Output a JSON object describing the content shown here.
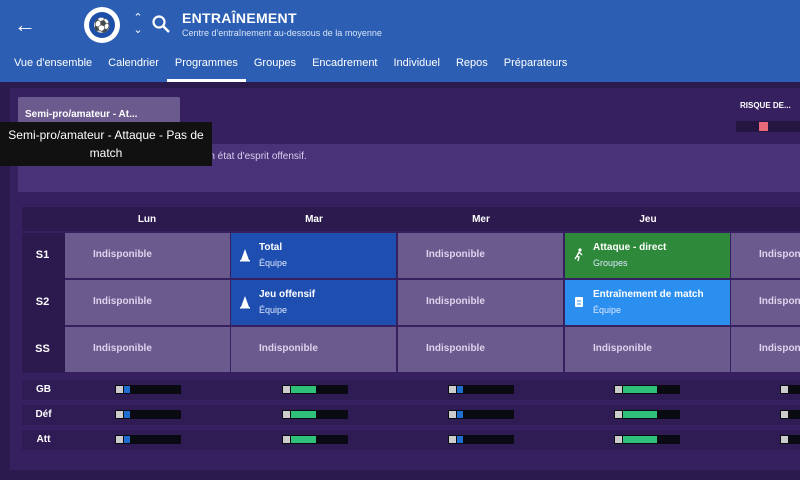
{
  "header": {
    "title": "ENTRAÎNEMENT",
    "subtitle": "Centre d'entraînement au-dessous de la moyenne"
  },
  "tabs": [
    {
      "label": "Vue d'ensemble"
    },
    {
      "label": "Calendrier"
    },
    {
      "label": "Programmes",
      "active": true
    },
    {
      "label": "Groupes"
    },
    {
      "label": "Encadrement"
    },
    {
      "label": "Individuel"
    },
    {
      "label": "Repos"
    },
    {
      "label": "Préparateurs"
    }
  ],
  "program": {
    "selected": "Semi-pro/amateur - At...",
    "tooltip": "Semi-pro/amateur - Attaque - Pas de match",
    "description": "Un programme d'entraînement basé sur un état d'esprit offensif.",
    "risk_label": "RISQUE DE..."
  },
  "days": [
    "Lun",
    "Mar",
    "Mer",
    "Jeu"
  ],
  "sessions": [
    "S1",
    "S2",
    "SS"
  ],
  "unavailable_label": "Indisponible",
  "cells": {
    "mar_s1": {
      "title": "Total",
      "sub": "Équipe"
    },
    "mar_s2": {
      "title": "Jeu offensif",
      "sub": "Équipe"
    },
    "jeu_s1": {
      "title": "Attaque - direct",
      "sub": "Groupes"
    },
    "jeu_s2": {
      "title": "Entraînement de match",
      "sub": "Équipe"
    }
  },
  "summary_rows": [
    "GB",
    "Déf",
    "Att"
  ],
  "load": {
    "Lun": 0.1,
    "Mar": 0.45,
    "Mer": 0.1,
    "Jeu": 0.6
  },
  "colors": {
    "header": "#2c5fb3",
    "unavailable": "#6b5a8e",
    "blue_dark": "#1e4fb0",
    "green": "#2e8a3a",
    "blue_light": "#2b8ff0",
    "risk": "#e86a7a"
  }
}
